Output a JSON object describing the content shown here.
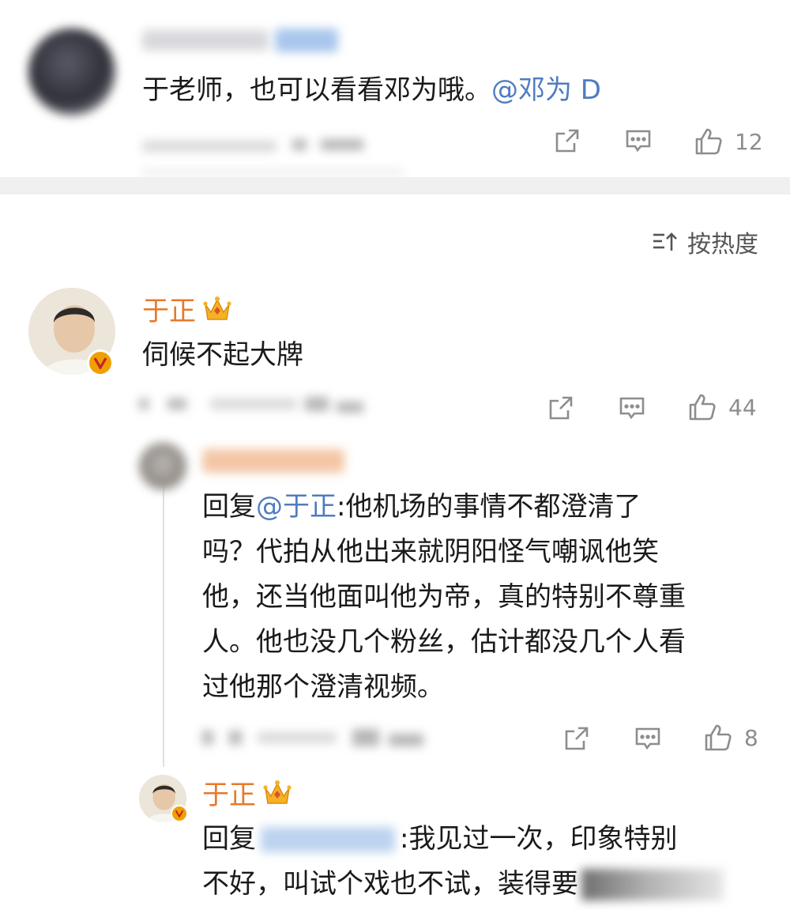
{
  "top_comment": {
    "text": "于老师，也可以看看邓为哦。",
    "mention": "@邓为 D",
    "like_count": "12"
  },
  "sort": {
    "label": "按热度",
    "icon": "sort-icon"
  },
  "main_comment": {
    "author": "于正",
    "text": "伺候不起大牌",
    "like_count": "44"
  },
  "reply1": {
    "prefix": "回复",
    "mention": "@于正",
    "lines": [
      ":他机场的事情不都澄清了",
      "吗？代拍从他出来就阴阳怪气嘲讽他笑",
      "他，还当他面叫他为帝，真的特别不尊重",
      "人。他也没几个粉丝，估计都没几个人看",
      "过他那个澄清视频。"
    ],
    "like_count": "8"
  },
  "reply2": {
    "author": "于正",
    "prefix": "回复",
    "line1": ":我见过一次，印象特别",
    "line2": "不好，叫试个戏也不试，装得要"
  },
  "colors": {
    "name": "#e8782a",
    "link": "#4f7cc0",
    "icon": "#8d8d8d",
    "divider": "#f0f0f0"
  }
}
